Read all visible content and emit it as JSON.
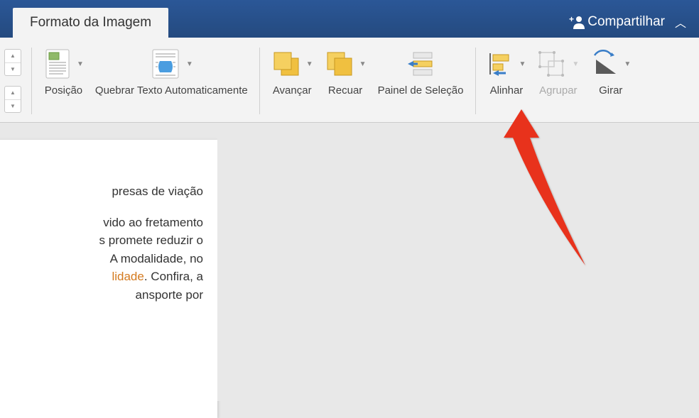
{
  "titlebar": {
    "active_tab": "Formato da Imagem",
    "search_placeholder_fragment": "",
    "share_label": "Compartilhar"
  },
  "ribbon": {
    "posicao": "Posição",
    "quebrar_texto": "Quebrar Texto Automaticamente",
    "avancar": "Avançar",
    "recuar": "Recuar",
    "painel_selecao": "Painel de Seleção",
    "alinhar": "Alinhar",
    "agrupar": "Agrupar",
    "girar": "Girar"
  },
  "document": {
    "line1": "presas de viação",
    "line2_a": "vido ao fretamento",
    "line2_b": "s promete reduzir o",
    "line2_c_before": "A modalidade, no",
    "line2_d_orange": "lidade",
    "line2_d_after": ". Confira, a",
    "line2_e": "ansporte por"
  }
}
